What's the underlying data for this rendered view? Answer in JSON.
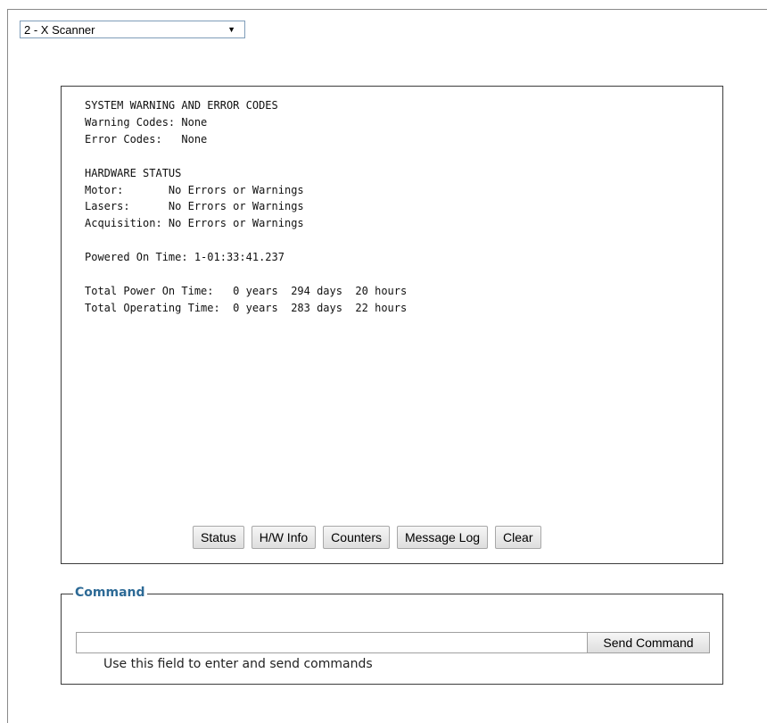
{
  "device_select": {
    "value": "2 - X Scanner"
  },
  "output": {
    "text": "SYSTEM WARNING AND ERROR CODES\nWarning Codes: None\nError Codes:   None\n\nHARDWARE STATUS\nMotor:       No Errors or Warnings\nLasers:      No Errors or Warnings\nAcquisition: No Errors or Warnings\n\nPowered On Time: 1-01:33:41.237\n\nTotal Power On Time:   0 years  294 days  20 hours\nTotal Operating Time:  0 years  283 days  22 hours"
  },
  "buttons": {
    "status": "Status",
    "hw_info": "H/W Info",
    "counters": "Counters",
    "message_log": "Message Log",
    "clear": "Clear"
  },
  "command": {
    "legend": "Command",
    "input_value": "",
    "send_label": "Send Command",
    "hint": "Use this field to enter and send commands"
  },
  "icons": {
    "dropdown": "chevron-down-icon"
  },
  "colors": {
    "legend": "#2d6a96",
    "border": "#3c3c3c"
  }
}
